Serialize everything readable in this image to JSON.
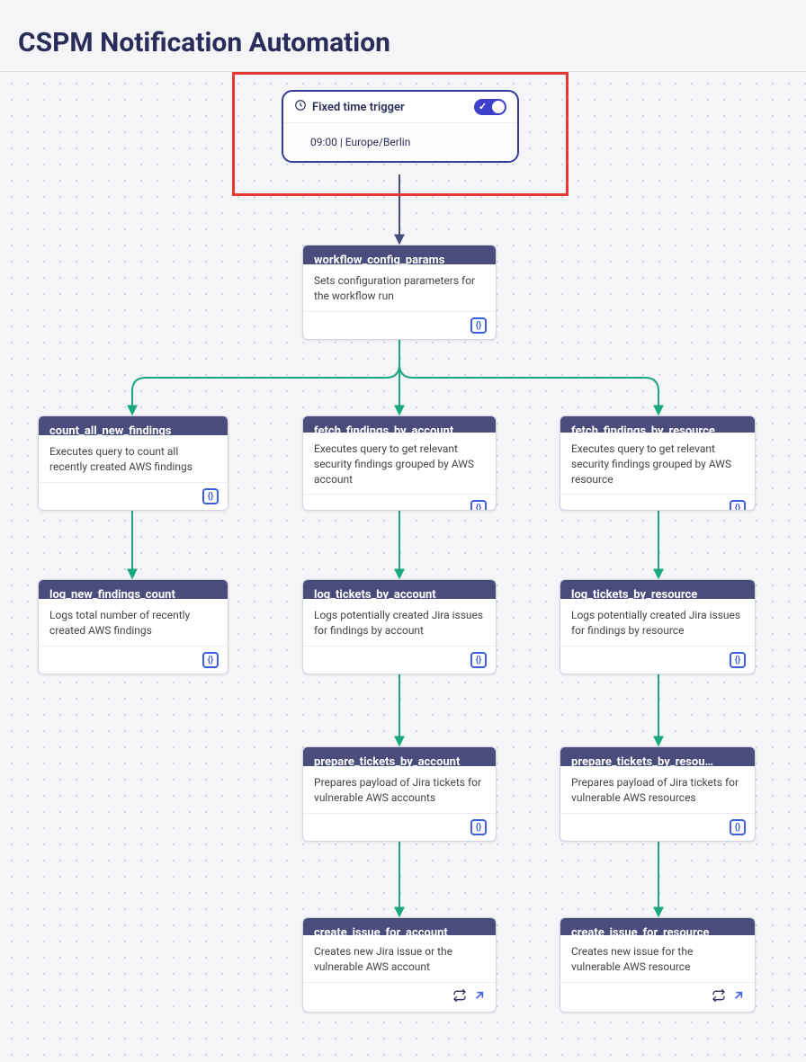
{
  "page": {
    "title": "CSPM Notification Automation"
  },
  "trigger": {
    "label": "Fixed time trigger",
    "schedule": "09:00 | Europe/Berlin",
    "enabled": true
  },
  "nodes": {
    "workflow_config_params": {
      "title": "workflow_config_params",
      "desc": "Sets configuration parameters for the workflow run",
      "icon": "code"
    },
    "count_all_new_findings": {
      "title": "count_all_new_findings",
      "desc": "Executes query to count all recently created AWS findings",
      "icon": "code"
    },
    "fetch_findings_by_account": {
      "title": "fetch_findings_by_account",
      "desc": "Executes query to get relevant security findings grouped by AWS account",
      "icon": "code"
    },
    "fetch_findings_by_resource": {
      "title": "fetch_findings_by_resource",
      "desc": "Executes query to get relevant security findings grouped by AWS resource",
      "icon": "code"
    },
    "log_new_findings_count": {
      "title": "log_new_findings_count",
      "desc": "Logs total number of recently created AWS findings",
      "icon": "code"
    },
    "log_tickets_by_account": {
      "title": "log_tickets_by_account",
      "desc": "Logs potentially created Jira issues for findings by account",
      "icon": "code"
    },
    "log_tickets_by_resource": {
      "title": "log_tickets_by_resource",
      "desc": "Logs potentially created Jira issues for findings by resource",
      "icon": "code"
    },
    "prepare_tickets_by_account": {
      "title": "prepare_tickets_by_account",
      "desc": "Prepares payload of Jira tickets for vulnerable AWS accounts",
      "icon": "code"
    },
    "prepare_tickets_by_resource": {
      "title": "prepare_tickets_by_resou…",
      "desc": "Prepares payload of Jira tickets for vulnerable AWS resources",
      "icon": "code"
    },
    "create_issue_for_account": {
      "title": "create_issue_for_account",
      "desc": "Creates new Jira issue or the vulnerable AWS account",
      "icon": "loop-arrow"
    },
    "create_issue_for_resource": {
      "title": "create_issue_for_resource",
      "desc": "Creates new issue for the vulnerable AWS resource",
      "icon": "loop-arrow"
    }
  }
}
